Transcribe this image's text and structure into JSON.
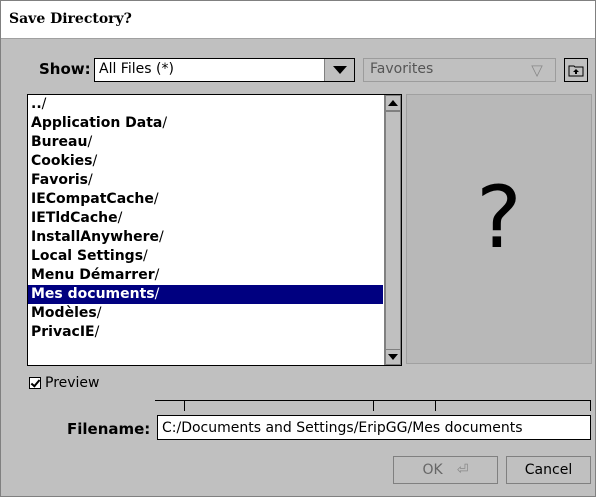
{
  "window": {
    "title": "Save Directory?"
  },
  "toolbar": {
    "show_label": "Show:",
    "show_value": "All Files (*)",
    "favorites_value": "Favorites"
  },
  "list": {
    "items": [
      {
        "name": "..",
        "slash": "/",
        "selected": false
      },
      {
        "name": "Application Data",
        "slash": "/",
        "selected": false
      },
      {
        "name": "Bureau",
        "slash": "/",
        "selected": false
      },
      {
        "name": "Cookies",
        "slash": "/",
        "selected": false
      },
      {
        "name": "Favoris",
        "slash": "/",
        "selected": false
      },
      {
        "name": "IECompatCache",
        "slash": "/",
        "selected": false
      },
      {
        "name": "IETldCache",
        "slash": "/",
        "selected": false
      },
      {
        "name": "InstallAnywhere",
        "slash": "/",
        "selected": false
      },
      {
        "name": "Local Settings",
        "slash": "/",
        "selected": false
      },
      {
        "name": "Menu Démarrer",
        "slash": "/",
        "selected": false
      },
      {
        "name": "Mes documents",
        "slash": "/",
        "selected": true
      },
      {
        "name": "Modèles",
        "slash": "/",
        "selected": false
      },
      {
        "name": "PrivacIE",
        "slash": "/",
        "selected": false
      }
    ]
  },
  "preview": {
    "placeholder": "?",
    "checkbox_label": "Preview",
    "checked": true
  },
  "filename": {
    "label": "Filename:",
    "value": "C:/Documents and Settings/EripGG/Mes documents"
  },
  "buttons": {
    "ok": "OK",
    "cancel": "Cancel"
  }
}
